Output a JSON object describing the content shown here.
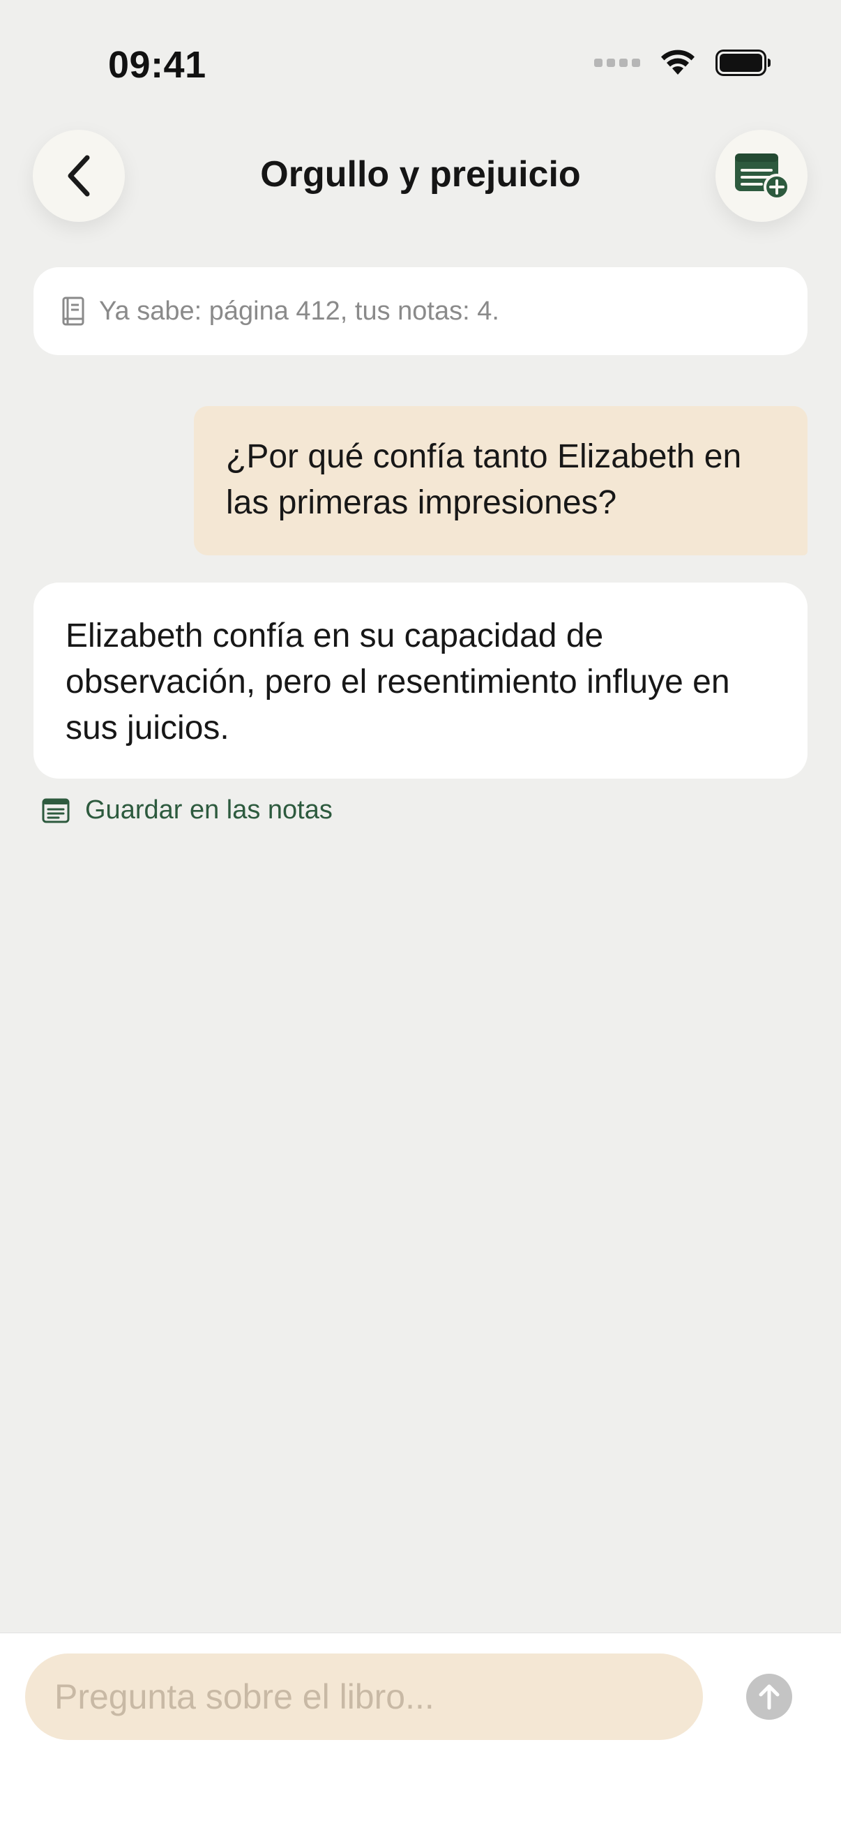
{
  "status_bar": {
    "time": "09:41",
    "icons": [
      "signal-icon",
      "wifi-icon",
      "battery-icon"
    ]
  },
  "header": {
    "title": "Orgullo y prejuicio",
    "back_icon": "chevron-left-icon",
    "action_icon": "note-add-icon"
  },
  "context_info": {
    "icon": "book-icon",
    "text": "Ya sabe: página 412, tus notas: 4."
  },
  "messages": [
    {
      "role": "user",
      "text": "¿Por qué confía tanto Elizabeth en las primeras impresiones?"
    },
    {
      "role": "assistant",
      "text": "Elizabeth confía en su capacidad de observación, pero el resentimiento influye en sus juicios."
    }
  ],
  "save_action": {
    "icon": "note-icon",
    "label": "Guardar en las notas"
  },
  "composer": {
    "placeholder": "Pregunta sobre el libro...",
    "value": "",
    "send_icon": "arrow-up-icon"
  },
  "colors": {
    "background": "#efefed",
    "user_bubble": "#f4e7d4",
    "accent_green": "#2d5a3e",
    "send_disabled": "#c4c4c4"
  }
}
